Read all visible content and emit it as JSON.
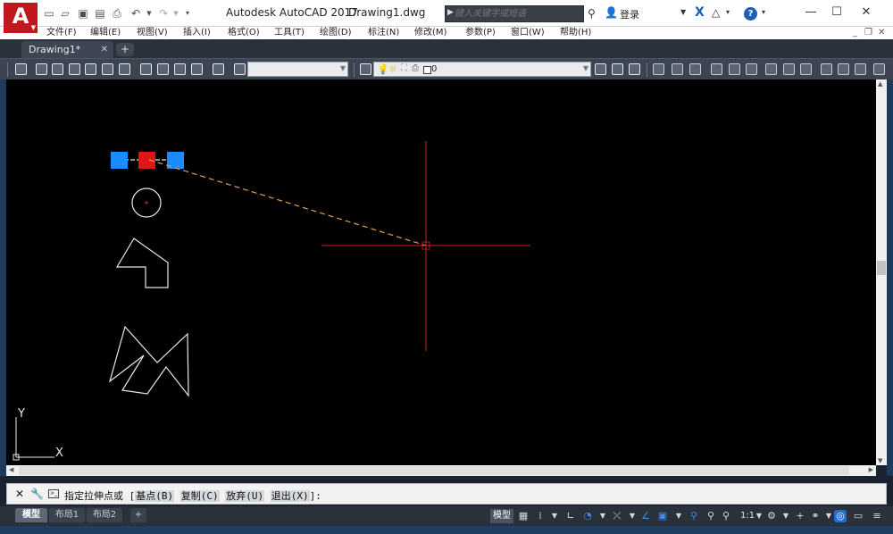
{
  "window": {
    "app_title": "Autodesk AutoCAD 2017",
    "doc_title": "Drawing1.dwg",
    "search_placeholder": "键入关键字或短语",
    "login_label": "登录",
    "logo_letter": "A",
    "help_label": "?",
    "minimize": "—",
    "maximize": "☐",
    "close": "✕"
  },
  "menu": {
    "items": [
      "文件(F)",
      "编辑(E)",
      "视图(V)",
      "插入(I)",
      "格式(O)",
      "工具(T)",
      "绘图(D)",
      "标注(N)",
      "修改(M)",
      "参数(P)",
      "窗口(W)",
      "帮助(H)"
    ],
    "mdi_minimize": "_",
    "mdi_restore": "❐",
    "mdi_close": "✕"
  },
  "file_tabs": {
    "active": "Drawing1*",
    "close": "✕",
    "new": "+"
  },
  "toolbar": {
    "layer_value": "0"
  },
  "command": {
    "prefix": "指定拉伸点或 [",
    "options": [
      "基点(B)",
      "复制(C)",
      "放弃(U)",
      "退出(X)"
    ],
    "suffix": "]:"
  },
  "layout_tabs": [
    "模型",
    "布局1",
    "布局2"
  ],
  "layout_tab_add": "+",
  "status": {
    "model_label": "模型",
    "scale": "1:1",
    "accent_blue": "#3d8fe8"
  },
  "ucs": {
    "x_label": "X",
    "y_label": "Y"
  },
  "colors": {
    "grip_hot": "#e01616",
    "grip_cold": "#1a8cff",
    "crosshair": "#d61f1f",
    "rubber_band": "#e0a050",
    "geometry": "#e8e8e8"
  }
}
